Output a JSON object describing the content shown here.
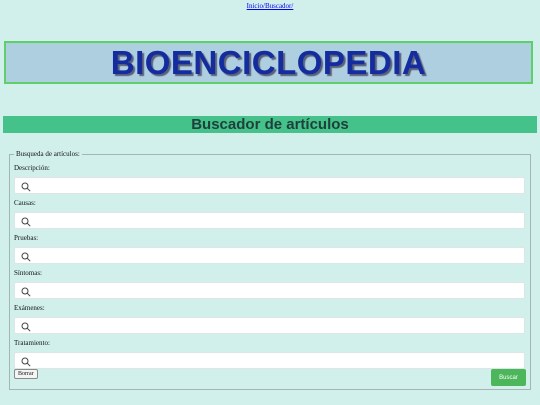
{
  "breadcrumb": {
    "home": "Inicio/",
    "search": "Buscador/"
  },
  "banner": {
    "title": "BIOENCICLOPEDIA"
  },
  "section": {
    "title": "Buscador de artículos"
  },
  "form": {
    "legend": "Busqueda de artículos:",
    "fields": [
      {
        "label": "Descripción:",
        "value": "",
        "icon": "search-icon"
      },
      {
        "label": "Causas:",
        "value": "",
        "icon": "search-icon"
      },
      {
        "label": "Pruebas:",
        "value": "",
        "icon": "search-icon"
      },
      {
        "label": "Síntomas:",
        "value": "",
        "icon": "search-icon"
      },
      {
        "label": "Exámenes:",
        "value": "",
        "icon": "search-icon"
      },
      {
        "label": "Tratamiento:",
        "value": "",
        "icon": "search-icon"
      }
    ],
    "clear_label": "Borrar",
    "search_label": "Buscar"
  },
  "colors": {
    "background": "#d1f0ec",
    "banner_bg": "#aecfe0",
    "banner_border": "#5fcf6a",
    "banner_text": "#142c9e",
    "section_bar": "#45c18a",
    "search_button": "#4cb65a"
  }
}
